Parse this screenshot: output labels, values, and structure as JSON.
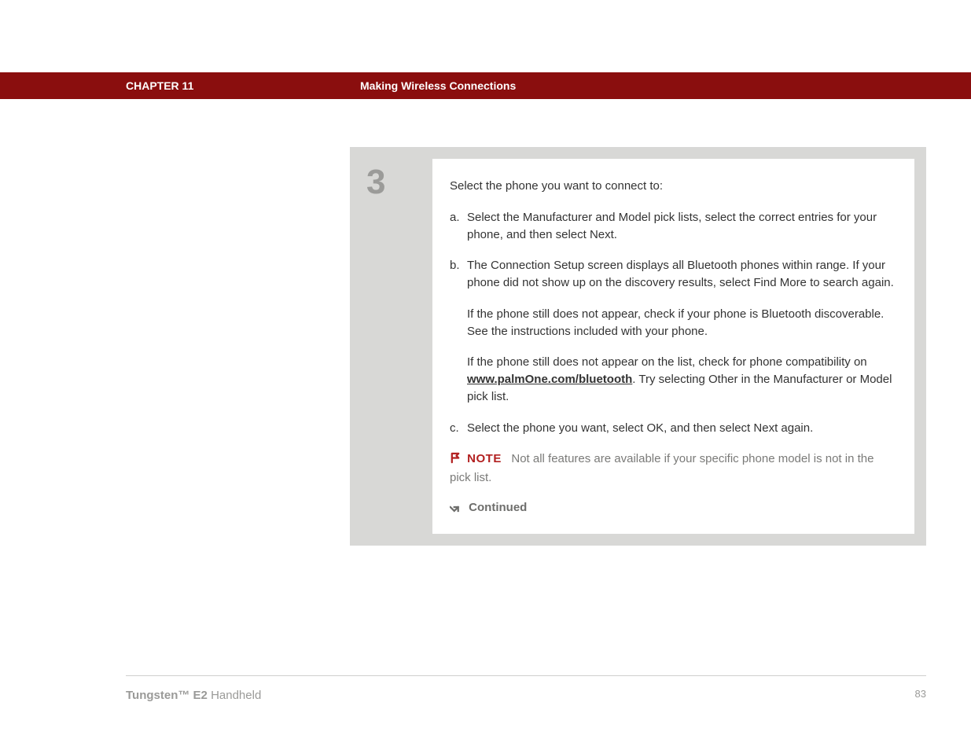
{
  "header": {
    "chapter": "CHAPTER 11",
    "title": "Making Wireless Connections"
  },
  "step": {
    "number": "3",
    "intro": "Select the phone you want to connect to:",
    "items": [
      {
        "marker": "a.",
        "text": "Select the Manufacturer and Model pick lists, select the correct entries for your phone, and then select Next."
      },
      {
        "marker": "b.",
        "text": "The Connection Setup screen displays all Bluetooth phones within range. If your phone did not show up on the discovery results, select Find More to search again.",
        "extra1": "If the phone still does not appear, check if your phone is Bluetooth discoverable. See the instructions included with your phone.",
        "extra2_pre": "If the phone still does not appear on the list, check for phone compatibility on ",
        "link": "www.palmOne.com/bluetooth",
        "extra2_post": ". Try selecting Other in the Manufacturer or Model pick list."
      },
      {
        "marker": "c.",
        "text": "Select the phone you want, select OK, and then select Next again."
      }
    ],
    "note_label": "NOTE",
    "note_text": "Not all features are available if your specific phone model is not in the pick list.",
    "continued_label": "Continued"
  },
  "footer": {
    "product_bold": "Tungsten™ E2",
    "product_light": " Handheld",
    "page": "83"
  }
}
